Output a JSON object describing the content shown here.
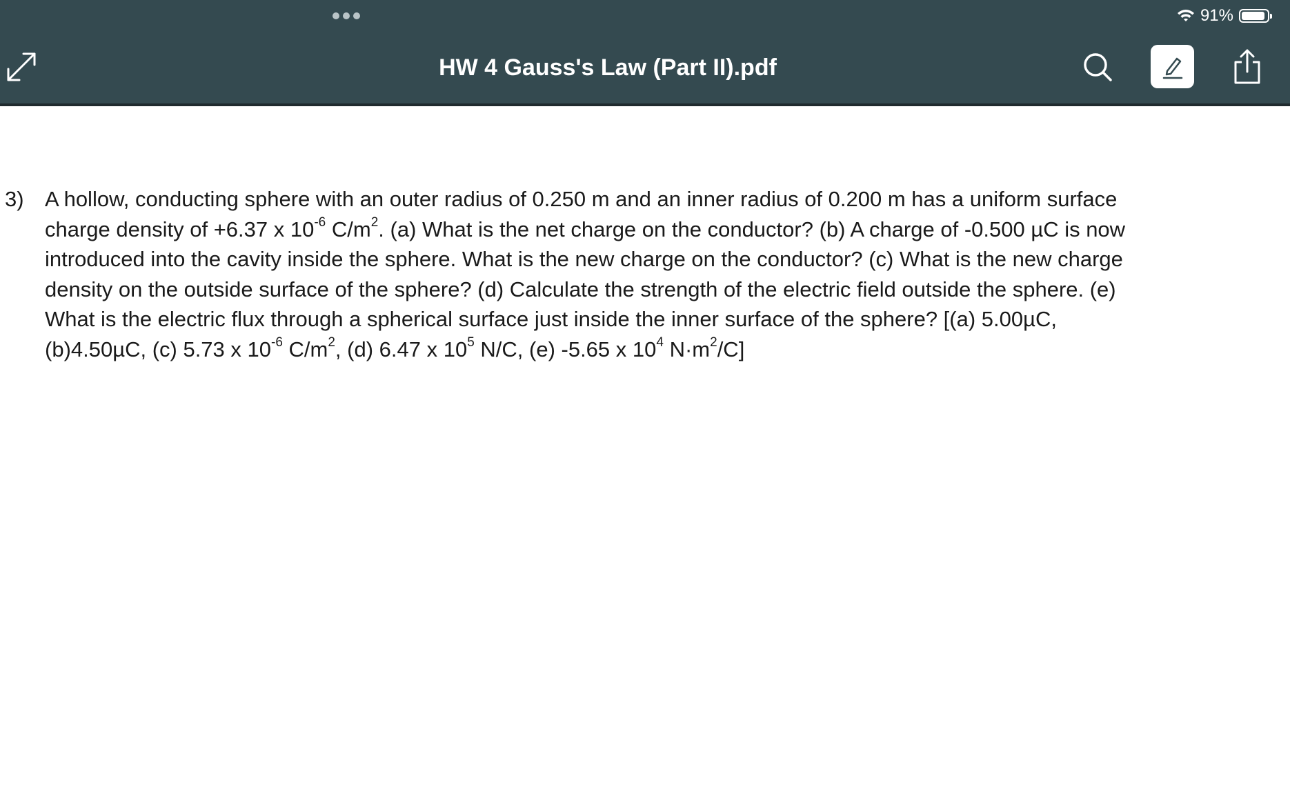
{
  "status_bar": {
    "battery_percent": "91%"
  },
  "toolbar": {
    "title": "HW 4 Gauss's Law (Part II).pdf",
    "icons": {
      "expand": "expand-icon",
      "search": "search-icon",
      "markup": "markup-pen-icon",
      "share": "share-icon"
    },
    "colors": {
      "bar_background": "#344a50",
      "markup_button": "#ffffff"
    }
  },
  "document": {
    "problem_number": "3)",
    "lines": {
      "l1": "A hollow, conducting sphere with an outer radius of 0.250 m and an inner radius of 0.200 m has a uniform surface",
      "l2a": "charge density of +6.37 x 10",
      "l2sup": "-6",
      "l2b": " C/m",
      "l2sup2": "2",
      "l2c": ". (a) What is the net charge on the conductor?  (b) A charge of -0.500 µC is now",
      "l3": "introduced into the cavity inside the sphere. What is the new charge on the conductor? (c) What is the new charge",
      "l4": "density on the outside surface of the sphere? (d) Calculate the strength of the electric field outside the sphere. (e)",
      "l5": "What is the electric flux through a spherical surface just inside the inner surface of the sphere?  [(a) 5.00µC,",
      "l6a": "(b)4.50µC,  (c) 5.73 x 10",
      "l6sup1": "-6",
      "l6b": " C/m",
      "l6sup2": "2",
      "l6c": ", (d) 6.47 x 10",
      "l6sup3": "5",
      "l6d": " N/C, (e) -5.65 x 10",
      "l6sup4": "4",
      "l6e": " N·m",
      "l6sup5": "2",
      "l6f": "/C]"
    }
  }
}
